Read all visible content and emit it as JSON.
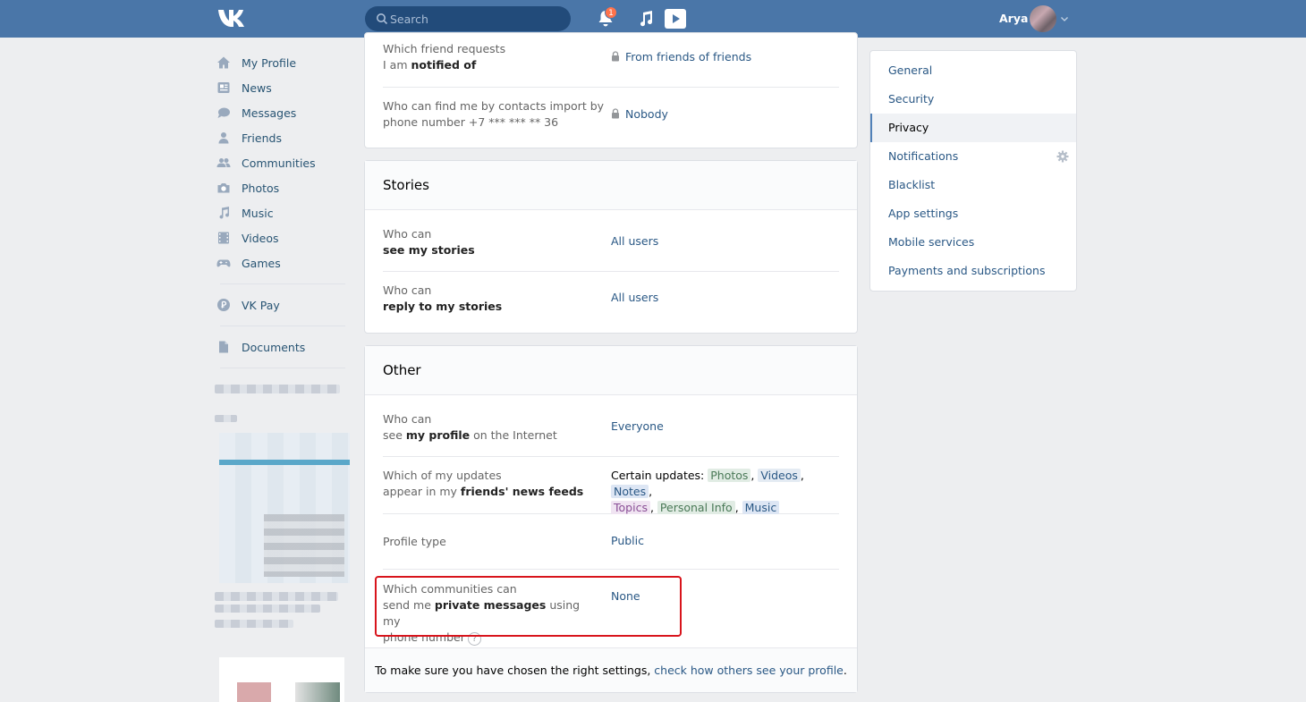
{
  "header": {
    "logo": "VK",
    "search_placeholder": "Search",
    "notifications_count": "1",
    "username": "Arya"
  },
  "leftnav": {
    "items": [
      {
        "label": "My Profile",
        "icon": "home-icon"
      },
      {
        "label": "News",
        "icon": "news-icon"
      },
      {
        "label": "Messages",
        "icon": "messages-icon"
      },
      {
        "label": "Friends",
        "icon": "friend-icon"
      },
      {
        "label": "Communities",
        "icon": "communities-icon"
      },
      {
        "label": "Photos",
        "icon": "camera-icon"
      },
      {
        "label": "Music",
        "icon": "music-icon"
      },
      {
        "label": "Videos",
        "icon": "video-icon"
      },
      {
        "label": "Games",
        "icon": "gamepad-icon"
      }
    ],
    "vkpay": "VK Pay",
    "documents": "Documents"
  },
  "top_card": {
    "rows": [
      {
        "label_line1": "Which friend requests",
        "label_line2_pre": "I am ",
        "label_line2_bold": "notified of",
        "value": "From friends of friends"
      },
      {
        "label_line1": "Who can find me by contacts import by",
        "label_line2": "phone number +7 *** *** ** 36",
        "value": "Nobody"
      }
    ]
  },
  "stories": {
    "title": "Stories",
    "rows": [
      {
        "label_line1": "Who can",
        "label_line2_bold": "see my stories",
        "value": "All users"
      },
      {
        "label_line1": "Who can",
        "label_line2_bold": "reply to my stories",
        "value": "All users"
      }
    ]
  },
  "other": {
    "title": "Other",
    "row1": {
      "label_line1": "Who can",
      "pre": "see ",
      "bold": "my profile",
      "post": " on the Internet",
      "value": "Everyone"
    },
    "row2": {
      "label_line1": "Which of my updates",
      "pre": "appear in my ",
      "bold": "friends' news feeds",
      "value_prefix": "Certain updates:",
      "tags": [
        "Photos",
        "Videos",
        "Notes",
        "Topics",
        "Personal Info",
        "Music"
      ]
    },
    "row3": {
      "label": "Profile type",
      "value": "Public"
    },
    "row4": {
      "label_line1": "Which communities can",
      "pre": "send me ",
      "bold": "private messages",
      "post": " using my",
      "label_line3": "phone number",
      "help": "?",
      "value": "None"
    },
    "footer_text": "To make sure you have chosen the right settings,",
    "footer_link": "check how others see your profile",
    "footer_end": "."
  },
  "rightmenu": {
    "items": [
      "General",
      "Security",
      "Privacy",
      "Notifications",
      "Blacklist",
      "App settings",
      "Mobile services",
      "Payments and subscriptions"
    ],
    "active": "Privacy"
  },
  "colors": {
    "header": "#4a76a8",
    "link": "#2a5885",
    "highlight_border": "#d8141c",
    "badge": "#ff734c"
  }
}
